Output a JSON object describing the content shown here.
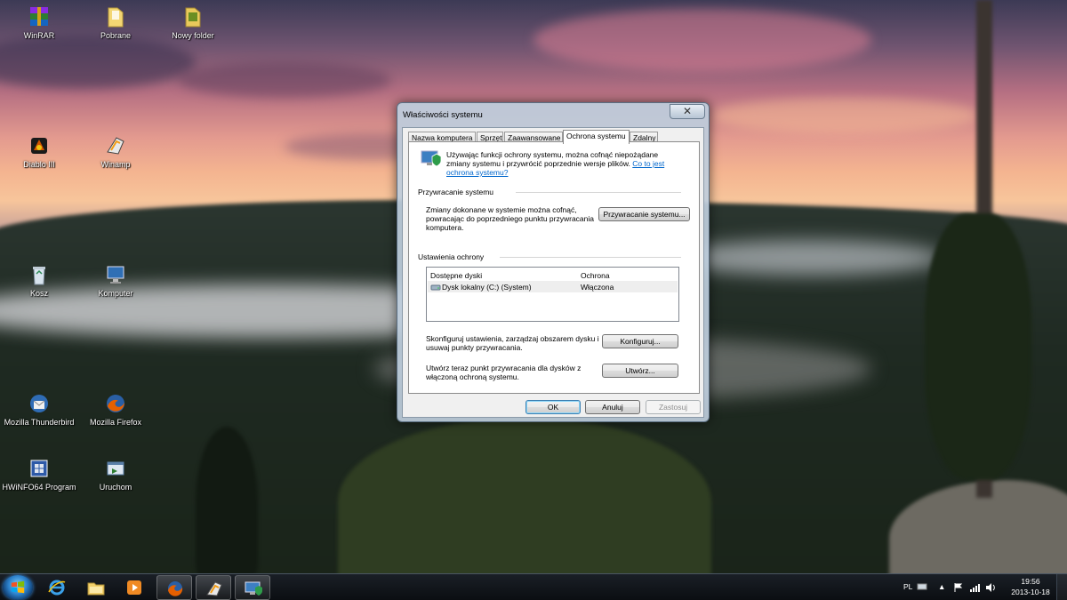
{
  "desktop": {
    "icons": [
      {
        "label": "WinRAR",
        "icon": "winrar-icon"
      },
      {
        "label": "Pobrane",
        "icon": "folder-icon"
      },
      {
        "label": "Nowy folder",
        "icon": "folder-icon"
      },
      {
        "label": "Diablo III",
        "icon": "diablo-icon"
      },
      {
        "label": "Winamp",
        "icon": "winamp-icon"
      },
      {
        "label": "Kosz",
        "icon": "recycle-bin-icon"
      },
      {
        "label": "Komputer",
        "icon": "computer-icon"
      },
      {
        "label": "Mozilla Thunderbird",
        "icon": "thunderbird-icon"
      },
      {
        "label": "Mozilla Firefox",
        "icon": "firefox-icon"
      },
      {
        "label": "HWiNFO64 Program",
        "icon": "hwinfo-icon"
      },
      {
        "label": "Uruchom",
        "icon": "run-icon"
      }
    ]
  },
  "dialog": {
    "title": "Właściwości systemu",
    "close_glyph": "✕",
    "tabs": [
      {
        "label": "Nazwa komputera",
        "active": false
      },
      {
        "label": "Sprzęt",
        "active": false
      },
      {
        "label": "Zaawansowane",
        "active": false
      },
      {
        "label": "Ochrona systemu",
        "active": true
      },
      {
        "label": "Zdalny",
        "active": false
      }
    ],
    "intro": {
      "line1": "Używając funkcji ochrony systemu, można cofnąć niepożądane",
      "line2_prefix": "zmiany systemu i przywrócić poprzednie wersje plików.",
      "link_part1": "Co to jest",
      "link_part2": "ochrona systemu?"
    },
    "restore_section": {
      "heading": "Przywracanie systemu",
      "desc_line1": "Zmiany dokonane w systemie można cofnąć,",
      "desc_line2": "powracając do poprzedniego punktu przywracania",
      "desc_line3": "komputera.",
      "button": "Przywracanie systemu..."
    },
    "protection_section": {
      "heading": "Ustawienia ochrony",
      "columns": [
        "Dostępne dyski",
        "Ochrona"
      ],
      "rows": [
        {
          "drive": "Dysk lokalny (C:) (System)",
          "protection": "Włączona"
        }
      ],
      "configure_line1": "Skonfiguruj ustawienia, zarządzaj obszarem dysku i",
      "configure_line2": "usuwaj punkty przywracania.",
      "configure_button": "Konfiguruj...",
      "create_line1": "Utwórz teraz punkt przywracania dla dysków z",
      "create_line2": "włączoną ochroną systemu.",
      "create_button": "Utwórz..."
    },
    "buttons": {
      "ok": "OK",
      "cancel": "Anuluj",
      "apply": "Zastosuj"
    }
  },
  "taskbar": {
    "pinned": [
      {
        "name": "internet-explorer-icon",
        "running": false
      },
      {
        "name": "explorer-folder-icon",
        "running": false
      },
      {
        "name": "media-player-icon",
        "running": false
      },
      {
        "name": "firefox-taskbar-icon",
        "running": true
      },
      {
        "name": "winamp-taskbar-icon",
        "running": true
      },
      {
        "name": "system-properties-taskbar-icon",
        "running": true
      }
    ],
    "tray": {
      "language": "PL",
      "time": "19:56",
      "date": "2013-10-18"
    }
  },
  "colors": {
    "link": "#0066cc",
    "dialog_frame": "#becddc",
    "taskbar": "#0b0e12"
  }
}
